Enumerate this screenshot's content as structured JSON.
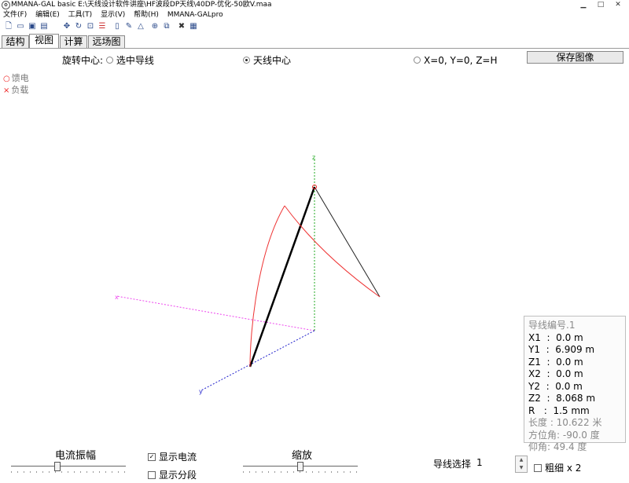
{
  "window": {
    "title": "MMANA-GAL basic  E:\\天线设计软件讲座\\HF波段DP天线\\40DP-优化-50欧V.maa",
    "minimize": "▁",
    "maximize": "□",
    "close": "✕"
  },
  "menu": [
    "文件(F)",
    "编辑(E)",
    "工具(T)",
    "显示(V)",
    "帮助(H)",
    "MMANA-GALpro"
  ],
  "toolbar_icons": [
    "new-file-icon",
    "open-folder-icon",
    "save-icon",
    "print-icon",
    "move-icon",
    "rotate-icon",
    "zoom-icon",
    "settings-icon",
    "document-icon",
    "edit-icon",
    "triangle-icon",
    "target-icon",
    "copy-icon",
    "tools-icon",
    "calculator-icon"
  ],
  "tabs": [
    {
      "label": "结构",
      "active": false
    },
    {
      "label": "视图",
      "active": true
    },
    {
      "label": "计算",
      "active": false
    },
    {
      "label": "远场图",
      "active": false
    }
  ],
  "rotation": {
    "label": "旋转中心:",
    "options": [
      {
        "label": "选中导线",
        "selected": false
      },
      {
        "label": "天线中心",
        "selected": true
      },
      {
        "label": "X=0, Y=0, Z=H",
        "selected": false
      }
    ]
  },
  "save_image_button": "保存图像",
  "legend": {
    "feed": {
      "marker": "○",
      "label": "馈电"
    },
    "load": {
      "marker": "×",
      "label": "负载"
    }
  },
  "axes": {
    "x_label": "x",
    "y_label": "y",
    "z_label": "z"
  },
  "colors": {
    "wire_selected": "#000000",
    "current_curve": "#e33333",
    "x_axis": "#ee44ee",
    "y_axis": "#2222cc",
    "z_axis": "#22aa22",
    "feed_marker": "#e22222"
  },
  "wire_info": {
    "title": "导线编号.1",
    "x1": "X1  :  0.0 m",
    "y1": "Y1  :  6.909 m",
    "z1": "Z1  :  0.0 m",
    "x2": "X2  :  0.0 m",
    "y2": "Y2  :  0.0 m",
    "z2": "Z2  :  8.068 m",
    "r": "R   :  1.5 mm",
    "length": "长度 : 10.622 米",
    "azimuth": "方位角: -90.0 度",
    "elevation": "仰角: 49.4 度"
  },
  "controls": {
    "current_amplitude_label": "电流振幅",
    "current_amplitude_level": 0.4,
    "show_current": {
      "label": "显示电流",
      "checked": true
    },
    "show_segments": {
      "label": "显示分段",
      "checked": false
    },
    "zoom_label": "缩放",
    "zoom_level": 0.5,
    "wire_select_label": "导线选择",
    "wire_select_value": "1",
    "thick_label": "粗细 x 2",
    "thick_checked": false
  }
}
